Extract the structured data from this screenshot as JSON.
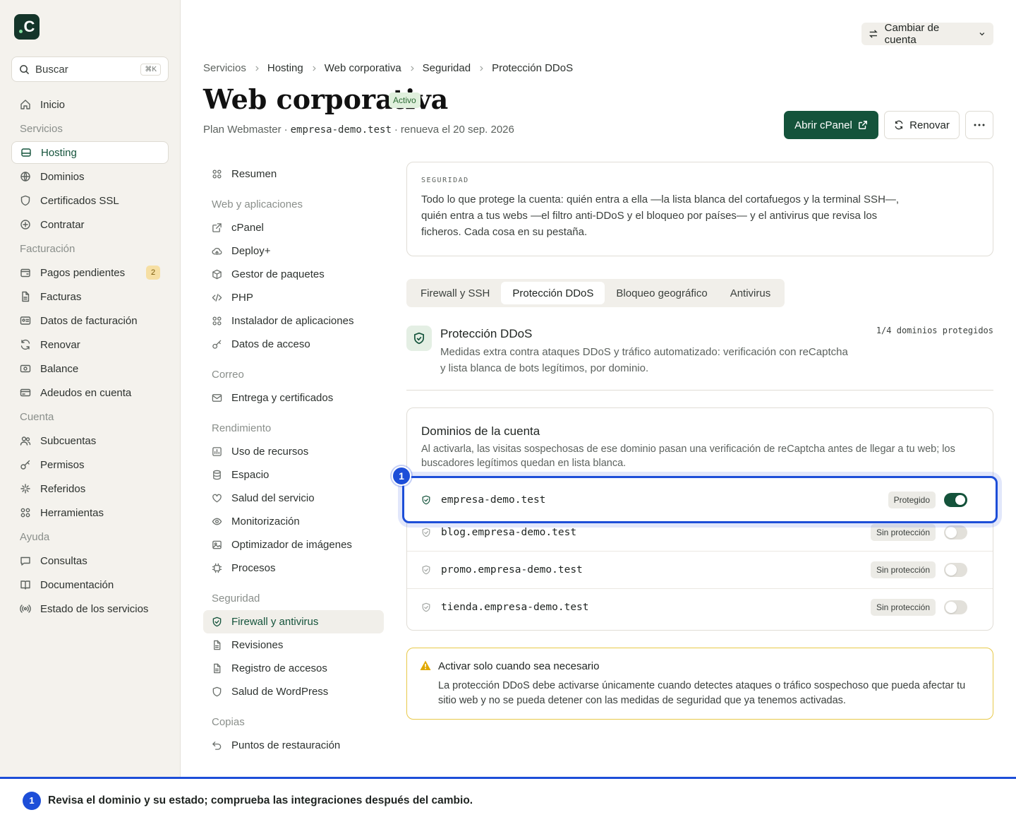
{
  "sidebar": {
    "logo_letter": "C",
    "search": {
      "placeholder": "Buscar",
      "shortcut": "⌘K"
    },
    "items": [
      {
        "type": "item",
        "label": "Inicio",
        "icon": "home-icon"
      },
      {
        "type": "section",
        "label": "Servicios"
      },
      {
        "type": "item",
        "label": "Hosting",
        "icon": "server-icon",
        "active": true
      },
      {
        "type": "item",
        "label": "Dominios",
        "icon": "globe-icon"
      },
      {
        "type": "item",
        "label": "Certificados SSL",
        "icon": "shield-icon"
      },
      {
        "type": "item",
        "label": "Contratar",
        "icon": "plus-circle-icon"
      },
      {
        "type": "section",
        "label": "Facturación"
      },
      {
        "type": "item",
        "label": "Pagos pendientes",
        "icon": "wallet-icon",
        "badge": "2"
      },
      {
        "type": "item",
        "label": "Facturas",
        "icon": "file-icon"
      },
      {
        "type": "item",
        "label": "Datos de facturación",
        "icon": "id-card-icon"
      },
      {
        "type": "item",
        "label": "Renovar",
        "icon": "refresh-icon"
      },
      {
        "type": "item",
        "label": "Balance",
        "icon": "banknote-icon"
      },
      {
        "type": "item",
        "label": "Adeudos en cuenta",
        "icon": "credit-card-icon"
      },
      {
        "type": "section",
        "label": "Cuenta"
      },
      {
        "type": "item",
        "label": "Subcuentas",
        "icon": "users-icon"
      },
      {
        "type": "item",
        "label": "Permisos",
        "icon": "key-icon"
      },
      {
        "type": "item",
        "label": "Referidos",
        "icon": "sparkles-icon"
      },
      {
        "type": "item",
        "label": "Herramientas",
        "icon": "grid-icon"
      },
      {
        "type": "section",
        "label": "Ayuda"
      },
      {
        "type": "item",
        "label": "Consultas",
        "icon": "chat-icon"
      },
      {
        "type": "item",
        "label": "Documentación",
        "icon": "book-icon"
      },
      {
        "type": "item",
        "label": "Estado de los servicios",
        "icon": "broadcast-icon"
      }
    ]
  },
  "header": {
    "switch_account": "Cambiar de cuenta",
    "breadcrumb": [
      "Servicios",
      "Hosting",
      "Web corporativa",
      "Seguridad",
      "Protección DDoS"
    ],
    "title": "Web corporativa",
    "status": "Activo",
    "plan": "Plan Webmaster",
    "domain": "empresa-demo.test",
    "renewal": "renueva el 20 sep. 2026",
    "dot": "·",
    "open_cpanel": "Abrir cPanel",
    "renew": "Renovar"
  },
  "subnav": [
    {
      "type": "item",
      "label": "Resumen",
      "icon": "grid-icon"
    },
    {
      "type": "section",
      "label": "Web y aplicaciones"
    },
    {
      "type": "item",
      "label": "cPanel",
      "icon": "external-link-icon"
    },
    {
      "type": "item",
      "label": "Deploy+",
      "icon": "cloud-upload-icon"
    },
    {
      "type": "item",
      "label": "Gestor de paquetes",
      "icon": "package-icon"
    },
    {
      "type": "item",
      "label": "PHP",
      "icon": "code-icon"
    },
    {
      "type": "item",
      "label": "Instalador de aplicaciones",
      "icon": "grid-icon"
    },
    {
      "type": "item",
      "label": "Datos de acceso",
      "icon": "key-icon"
    },
    {
      "type": "section",
      "label": "Correo"
    },
    {
      "type": "item",
      "label": "Entrega y certificados",
      "icon": "mail-icon"
    },
    {
      "type": "section",
      "label": "Rendimiento"
    },
    {
      "type": "item",
      "label": "Uso de recursos",
      "icon": "chart-icon"
    },
    {
      "type": "item",
      "label": "Espacio",
      "icon": "database-icon"
    },
    {
      "type": "item",
      "label": "Salud del servicio",
      "icon": "heart-icon"
    },
    {
      "type": "item",
      "label": "Monitorización",
      "icon": "eye-icon"
    },
    {
      "type": "item",
      "label": "Optimizador de imágenes",
      "icon": "image-icon"
    },
    {
      "type": "item",
      "label": "Procesos",
      "icon": "cpu-icon"
    },
    {
      "type": "section",
      "label": "Seguridad"
    },
    {
      "type": "item",
      "label": "Firewall y antivirus",
      "icon": "shield-check-icon",
      "active": true
    },
    {
      "type": "item",
      "label": "Revisiones",
      "icon": "file-icon"
    },
    {
      "type": "item",
      "label": "Registro de accesos",
      "icon": "file-icon"
    },
    {
      "type": "item",
      "label": "Salud de WordPress",
      "icon": "shield-icon"
    },
    {
      "type": "section",
      "label": "Copias"
    },
    {
      "type": "item",
      "label": "Puntos de restauración",
      "icon": "undo-icon"
    }
  ],
  "intro": {
    "eyebrow": "SEGURIDAD",
    "text": "Todo lo que protege la cuenta: quién entra a ella —la lista blanca del cortafuegos y la terminal SSH—, quién entra a tus webs —el filtro anti-DDoS y el bloqueo por países— y el antivirus que revisa los ficheros. Cada cosa en su pestaña."
  },
  "tabs": [
    {
      "label": "Firewall y SSH"
    },
    {
      "label": "Protección DDoS",
      "active": true
    },
    {
      "label": "Bloqueo geográfico"
    },
    {
      "label": "Antivirus"
    }
  ],
  "section": {
    "title": "Protección DDoS",
    "description": "Medidas extra contra ataques DDoS y tráfico automatizado: verificación con reCaptcha y lista blanca de bots legítimos, por dominio.",
    "count": "1/4 dominios protegidos"
  },
  "domains": {
    "title": "Dominios de la cuenta",
    "description": "Al activarla, las visitas sospechosas de ese dominio pasan una verificación de reCaptcha antes de llegar a tu web; los buscadores legítimos quedan en lista blanca.",
    "rows": [
      {
        "name": "empresa-demo.test",
        "status": "Protegido",
        "enabled": true
      },
      {
        "name": "blog.empresa-demo.test",
        "status": "Sin protección",
        "enabled": false
      },
      {
        "name": "promo.empresa-demo.test",
        "status": "Sin protección",
        "enabled": false
      },
      {
        "name": "tienda.empresa-demo.test",
        "status": "Sin protección",
        "enabled": false
      }
    ]
  },
  "warning": {
    "title": "Activar solo cuando sea necesario",
    "text": "La protección DDoS debe activarse únicamente cuando detectes ataques o tráfico sospechoso que pueda afectar tu sitio web y no se pueda detener con las medidas de seguridad que ya tenemos activadas."
  },
  "annotation": {
    "number": "1",
    "text": "Revisa el dominio y su estado; comprueba las integraciones después del cambio."
  },
  "colors": {
    "accent": "#14533b",
    "highlight": "#1d4ed8",
    "warning": "#e8c94a"
  }
}
